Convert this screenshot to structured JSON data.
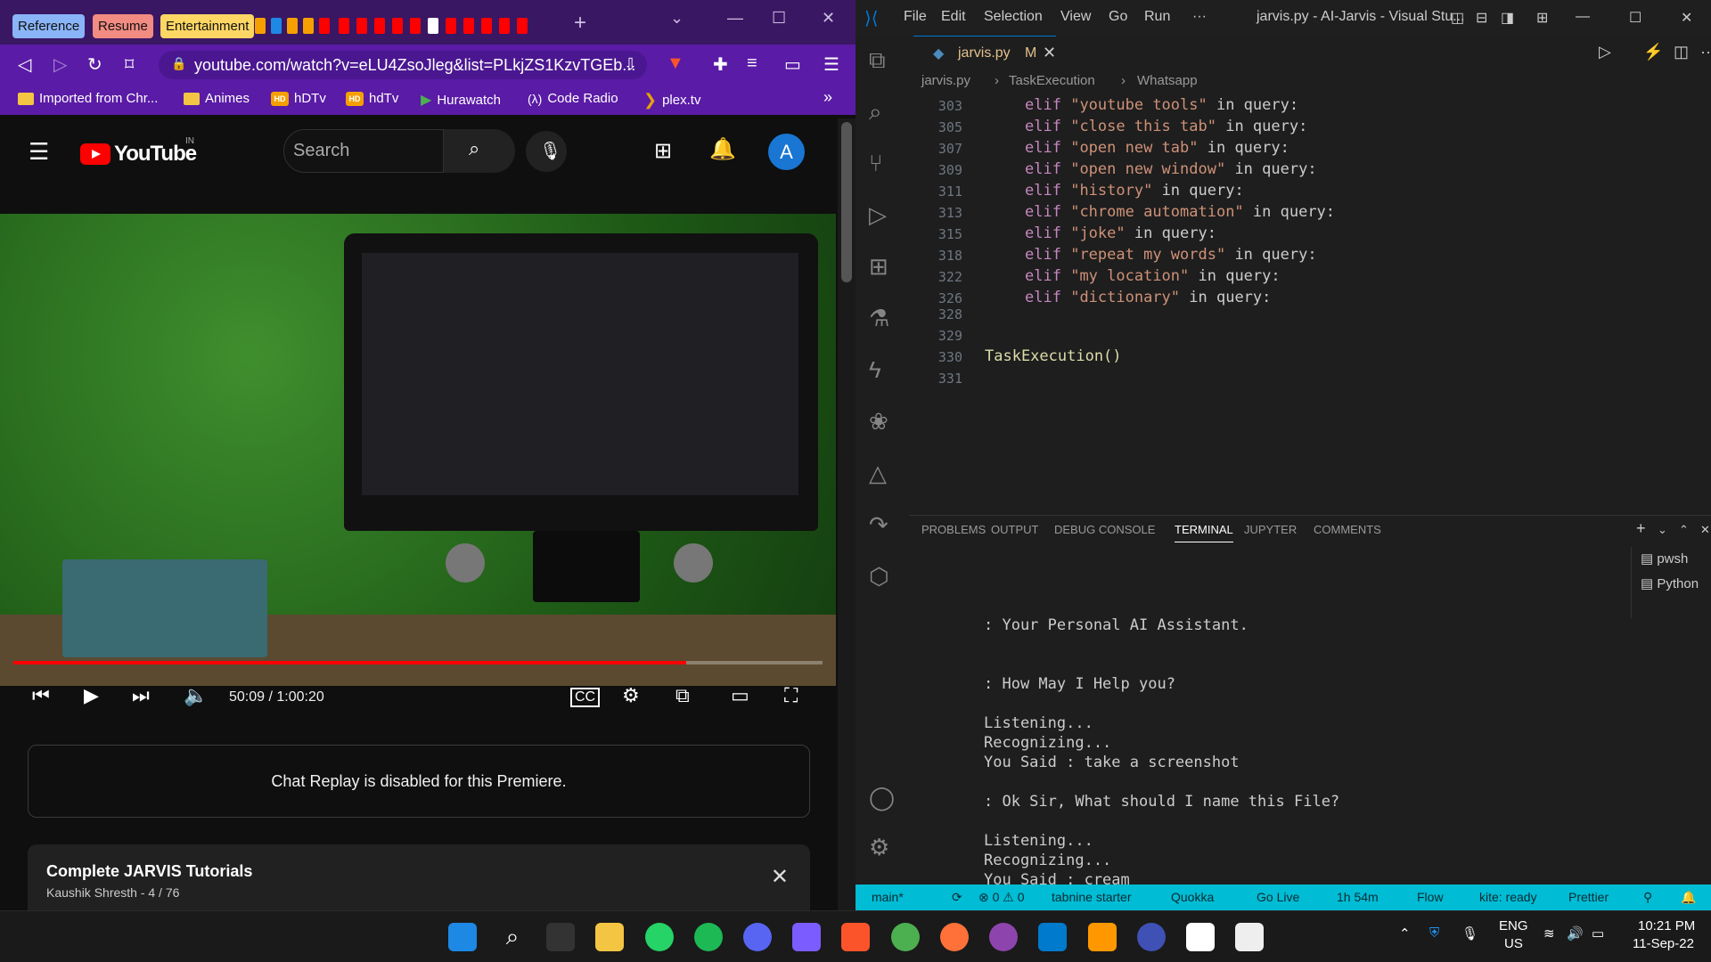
{
  "browser": {
    "tab_groups": [
      {
        "label": "Reference",
        "color": "#8ab4f8"
      },
      {
        "label": "Resume",
        "color": "#f28b82"
      },
      {
        "label": "Entertainment",
        "color": "#fdd663"
      }
    ],
    "new_tab": "+",
    "url": "youtube.com/watch?v=eLU4ZsoJleg&list=PLkjZS1KzvTGEb...",
    "bookmarks": [
      "Imported from Chr...",
      "Animes",
      "hDTv",
      "hdTv",
      "Hurawatch",
      "Code Radio",
      "plex.tv"
    ],
    "more": "»"
  },
  "youtube": {
    "logo": "YouTube",
    "country": "IN",
    "search_placeholder": "Search",
    "avatar_letter": "A",
    "time": "50:09 / 1:00:20",
    "progress": 0.831,
    "chat_replay": "Chat Replay is disabled for this Premiere.",
    "playlist_title": "Complete JARVIS Tutorials",
    "playlist_sub": "Kaushik Shresth - 4 / 76"
  },
  "vscode": {
    "menu": [
      "File",
      "Edit",
      "Selection",
      "View",
      "Go",
      "Run",
      "···"
    ],
    "title": "jarvis.py - AI-Jarvis - Visual Stu...",
    "tab": {
      "name": "jarvis.py",
      "modified": "M"
    },
    "breadcrumb": [
      "jarvis.py",
      "TaskExecution",
      "Whatsapp"
    ],
    "code_lines": [
      {
        "ln": "303",
        "kw": "elif",
        "str": "\"youtube tools\"",
        "rest": " in query:"
      },
      {
        "ln": "305",
        "kw": "elif",
        "str": "\"close this tab\"",
        "rest": " in query:"
      },
      {
        "ln": "307",
        "kw": "elif",
        "str": "\"open new tab\"",
        "rest": " in query:"
      },
      {
        "ln": "309",
        "kw": "elif",
        "str": "\"open new window\"",
        "rest": " in query:"
      },
      {
        "ln": "311",
        "kw": "elif",
        "str": "\"history\"",
        "rest": " in query:"
      },
      {
        "ln": "313",
        "kw": "elif",
        "str": "\"chrome automation\"",
        "rest": " in query:"
      },
      {
        "ln": "315",
        "kw": "elif",
        "str": "\"joke\"",
        "rest": " in query:"
      },
      {
        "ln": "318",
        "kw": "elif",
        "str": "\"repeat my words\"",
        "rest": " in query:"
      },
      {
        "ln": "322",
        "kw": "elif",
        "str": "\"my location\"",
        "rest": " in query:"
      },
      {
        "ln": "326",
        "kw": "elif",
        "str": "\"dictionary\"",
        "rest": " in query:"
      }
    ],
    "ln_328": "328",
    "ln_329": "329",
    "ln_330": "330",
    "ln_331": "331",
    "call": "TaskExecution()",
    "panel_tabs": [
      "PROBLEMS",
      "OUTPUT",
      "DEBUG CONSOLE",
      "TERMINAL",
      "JUPYTER",
      "COMMENTS"
    ],
    "terminal": [
      ": Your Personal AI Assistant.",
      "",
      "",
      ": How May I Help you?",
      "",
      "Listening...",
      "Recognizing...",
      "You Said : take a screenshot",
      "",
      ": Ok Sir, What should I name this File?",
      "",
      "Listening...",
      "Recognizing...",
      "You Said : cream"
    ],
    "terminal_list": [
      "pwsh",
      "Python"
    ],
    "status": [
      "main*",
      "⟳",
      "⊗ 0 ⚠ 0",
      "tabnine starter",
      "Quokka",
      "Go Live",
      "1h 54m",
      "Flow",
      "kite: ready",
      "Prettier"
    ]
  },
  "taskbar": {
    "lang": "ENG",
    "region": "US",
    "time": "10:21 PM",
    "date": "11-Sep-22"
  }
}
